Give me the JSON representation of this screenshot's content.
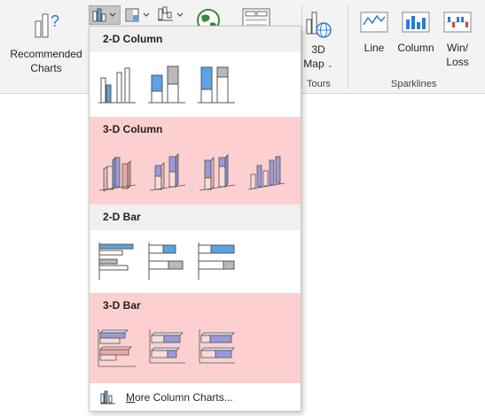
{
  "ribbon": {
    "recommended_label_line1": "Recommended",
    "recommended_label_line2": "Charts",
    "map3d_label_line1": "3D",
    "map3d_label_line2": "Map",
    "tours_group_label": "Tours",
    "line_label": "Line",
    "column_label": "Column",
    "winloss_label_line1": "Win/",
    "winloss_label_line2": "Loss",
    "sparklines_group_label": "Sparklines"
  },
  "dropdown": {
    "sections": [
      {
        "title": "2-D Column",
        "highlighted": false
      },
      {
        "title": "3-D Column",
        "highlighted": true
      },
      {
        "title": "2-D Bar",
        "highlighted": false
      },
      {
        "title": "3-D Bar",
        "highlighted": true
      }
    ],
    "footer_accesskey": "M",
    "footer_rest": "ore Column Charts..."
  },
  "colors": {
    "ribbon_bg": "#f3f3f3",
    "highlight": "#fcd0d0",
    "accent_blue": "#5ba3e3",
    "gray": "#b9b9b9",
    "green": "#3b8a3e"
  }
}
